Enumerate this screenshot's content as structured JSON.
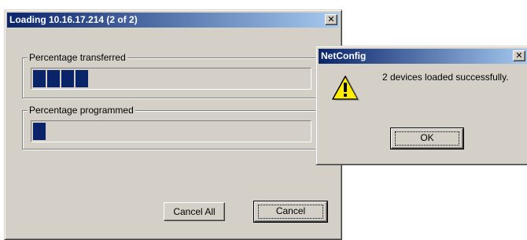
{
  "loading_dialog": {
    "title": "Loading 10.16.17.214 (2 of 2)",
    "close_glyph": "✕",
    "transferred_group": {
      "label": "Percentage transferred",
      "blocks_filled": 4
    },
    "programmed_group": {
      "label": "Percentage programmed",
      "blocks_filled": 1
    },
    "cancel_all_label": "Cancel All",
    "cancel_label": "Cancel"
  },
  "message_box": {
    "title": "NetConfig",
    "close_glyph": "✕",
    "icon": "warning-icon",
    "message": "2 devices loaded successfully.",
    "ok_label": "OK"
  },
  "colors": {
    "title_start": "#0a246a",
    "title_end": "#a6caf0",
    "progress_block": "#0a246a",
    "window_face": "#d4d0c8"
  }
}
